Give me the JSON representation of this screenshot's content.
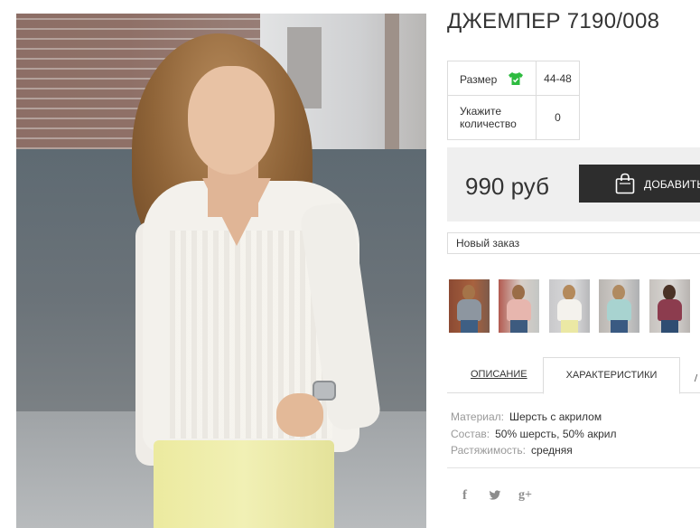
{
  "product": {
    "title": "ДЖЕМПЕР 7190/008"
  },
  "options": {
    "size_label": "Размер",
    "size_value": "44-48",
    "qty_label": "Укажите количество",
    "qty_value": "0",
    "size_icon": "tshirt-icon",
    "size_icon_color": "#2dbb3f"
  },
  "purchase": {
    "price": "990 руб",
    "add_button_label": "ДОБАВИТЬ",
    "add_button_icon": "shopping-bag-icon"
  },
  "order_select": {
    "selected": "Новый заказ"
  },
  "thumbnails": [
    {
      "alt": "thumbnail-1"
    },
    {
      "alt": "thumbnail-2"
    },
    {
      "alt": "thumbnail-3"
    },
    {
      "alt": "thumbnail-4"
    },
    {
      "alt": "thumbnail-5"
    }
  ],
  "tabs": {
    "description": "ОПИСАНИЕ",
    "characteristics": "ХАРАКТЕРИСТИКИ"
  },
  "specs": [
    {
      "label": "Материал:",
      "value": "Шерсть с акрилом"
    },
    {
      "label": "Состав:",
      "value": "50% шерсть, 50% акрил"
    },
    {
      "label": "Растяжимость:",
      "value": "средняя"
    }
  ],
  "social": {
    "facebook": "f",
    "twitter": "🐦",
    "googleplus": "g+"
  },
  "colors": {
    "button_bg": "#2d2d2d",
    "price_box_bg": "#efefef",
    "border": "#dcdcdc",
    "spec_label": "#999999"
  }
}
